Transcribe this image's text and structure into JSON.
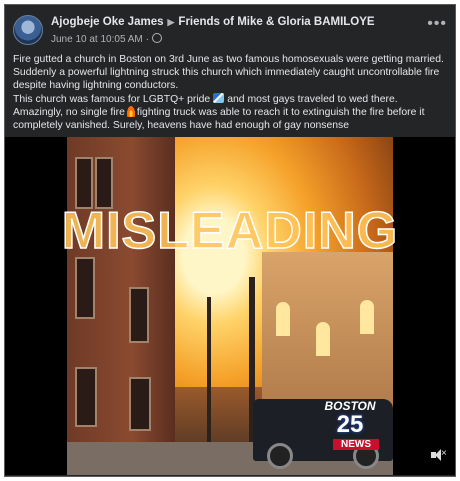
{
  "post": {
    "author": "Ajogbeje Oke James",
    "group": "Friends of Mike & Gloria BAMILOYE",
    "timestamp": "June 10 at 10:05 AM",
    "text": {
      "line1": "Fire gutted a church in Boston on 3rd June as two famous homosexuals were getting married.",
      "line2": "Suddenly a powerful lightning struck this church which immediately caught uncontrollable fire",
      "line3": "despite having lightning conductors.",
      "line4a": "This church was famous for LGBTQ+ pride",
      "line4b": "and most gays traveled to wed there.",
      "line5a": "Amazingly, no single fire",
      "line5b": "fighting truck was able to reach it to extinguish the fire before it",
      "line6": "completely vanished. Surely, heavens have had enough of gay nonsense"
    }
  },
  "video": {
    "overlay_label": "MISLEADING",
    "news_logo": {
      "city": "BOSTON",
      "channel": "25",
      "brand": "NEWS"
    }
  },
  "icons": {
    "avatar": "avatar",
    "group_arrow": "triangle-right-icon",
    "privacy": "globe-icon",
    "more": "more-options-icon",
    "rainbow": "rainbow-flag-icon",
    "fire": "fire-icon",
    "volume": "mute-icon"
  },
  "colors": {
    "card_bg": "#242526",
    "text_primary": "#e4e6eb",
    "text_secondary": "#b0b3b8",
    "overlay_text": "#ffc45a"
  }
}
